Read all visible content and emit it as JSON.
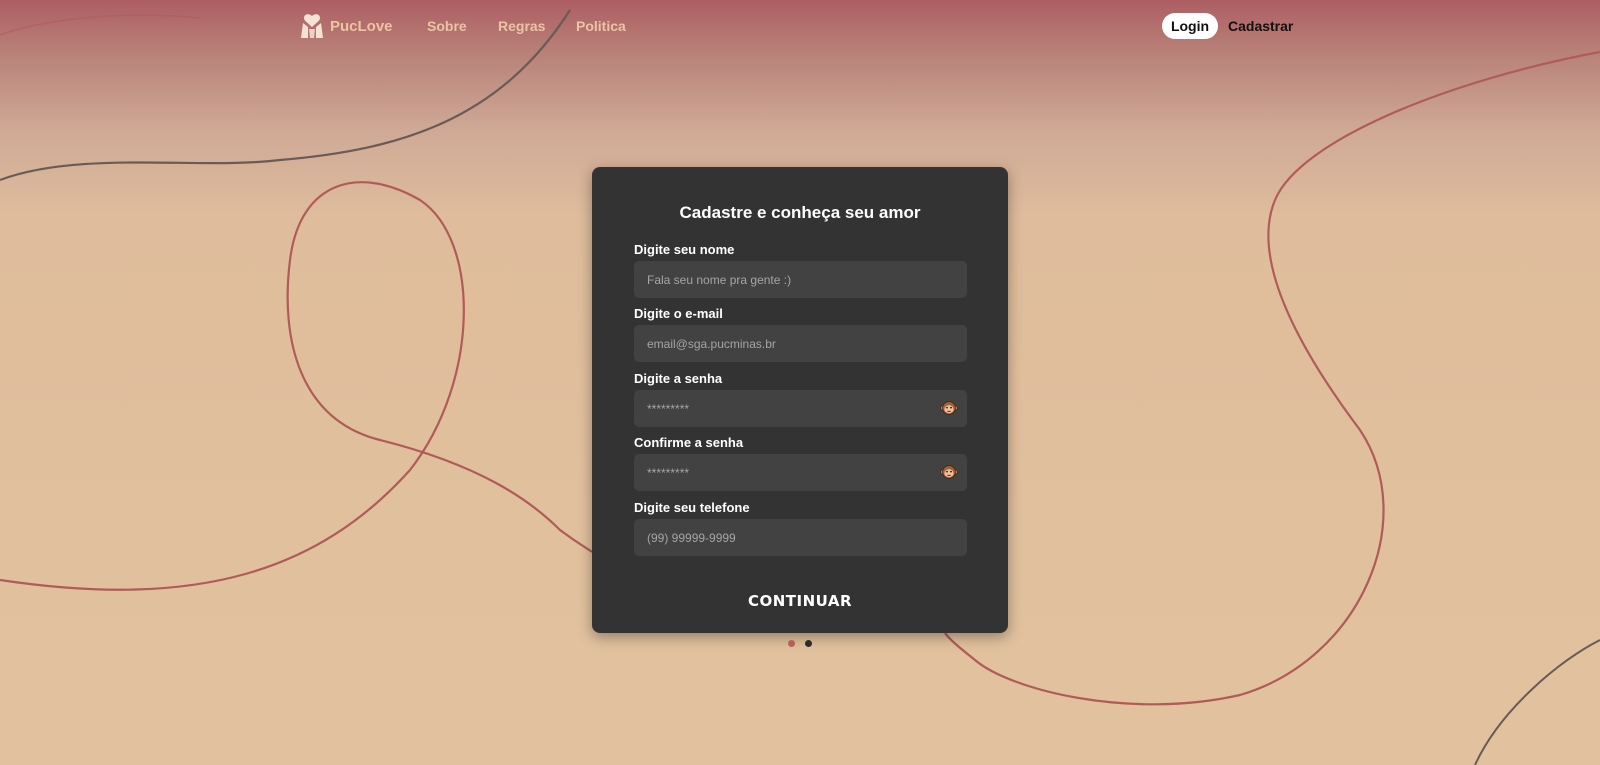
{
  "navbar": {
    "brand": "PucLove",
    "links": [
      "Sobre",
      "Regras",
      "Politica"
    ],
    "login": "Login",
    "signup": "Cadastrar"
  },
  "form": {
    "title": "Cadastre e conheça seu amor",
    "fields": [
      {
        "label": "Digite seu nome",
        "placeholder": "Fala seu nome pra gente :)",
        "value": ""
      },
      {
        "label": "Digite o e-mail",
        "placeholder": "email@sga.pucminas.br",
        "value": ""
      },
      {
        "label": "Digite a senha",
        "placeholder": "*********",
        "value": ""
      },
      {
        "label": "Confirme a senha",
        "placeholder": "*********",
        "value": ""
      },
      {
        "label": "Digite seu telefone",
        "placeholder": "(99) 99999-9999",
        "value": ""
      }
    ],
    "submit": "CONTINUAR"
  },
  "pagination": {
    "current": 1,
    "total": 2
  },
  "icons": {
    "brand": "heart-hands-icon",
    "password_toggle": "monkey-icon"
  },
  "colors": {
    "card": "#333333",
    "input": "#424242",
    "accent": "#ecc4a4",
    "dot_active": "#b85f5c",
    "dot_inactive": "#2b2b2b",
    "curve_red": "#b15b58",
    "curve_gray": "#6a5a58"
  }
}
